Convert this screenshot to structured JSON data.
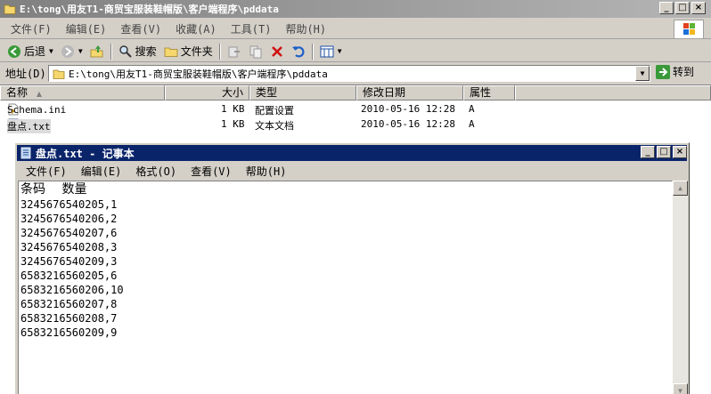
{
  "explorer": {
    "title": "E:\\tong\\用友T1-商贸宝服装鞋帽版\\客户端程序\\pddata",
    "menu": [
      "文件(F)",
      "编辑(E)",
      "查看(V)",
      "收藏(A)",
      "工具(T)",
      "帮助(H)"
    ],
    "toolbar": {
      "back_label": "后退",
      "search_label": "搜索",
      "folders_label": "文件夹"
    },
    "address": {
      "label": "地址(D)",
      "path": "E:\\tong\\用友T1-商贸宝服装鞋帽版\\客户端程序\\pddata",
      "go_label": "转到"
    },
    "columns": [
      "名称",
      "大小",
      "类型",
      "修改日期",
      "属性"
    ],
    "files": [
      {
        "name": "Schema.ini",
        "size": "1 KB",
        "type": "配置设置",
        "modified": "2010-05-16 12:28",
        "attr": "A"
      },
      {
        "name": "盘点.txt",
        "size": "1 KB",
        "type": "文本文档",
        "modified": "2010-05-16 12:28",
        "attr": "A"
      }
    ]
  },
  "notepad": {
    "title": "盘点.txt - 记事本",
    "menu": [
      "文件(F)",
      "编辑(E)",
      "格式(O)",
      "查看(V)",
      "帮助(H)"
    ],
    "header_line": "条码 数量",
    "lines": [
      "3245676540205,1",
      "3245676540206,2",
      "3245676540207,6",
      "3245676540208,3",
      "3245676540209,3",
      "6583216560205,6",
      "6583216560206,10",
      "6583216560207,8",
      "6583216560208,7",
      "6583216560209,9"
    ]
  },
  "colors": {
    "inactive_title_start": "#808080",
    "active_title": "#0a246a",
    "chrome": "#d4d0c8"
  }
}
